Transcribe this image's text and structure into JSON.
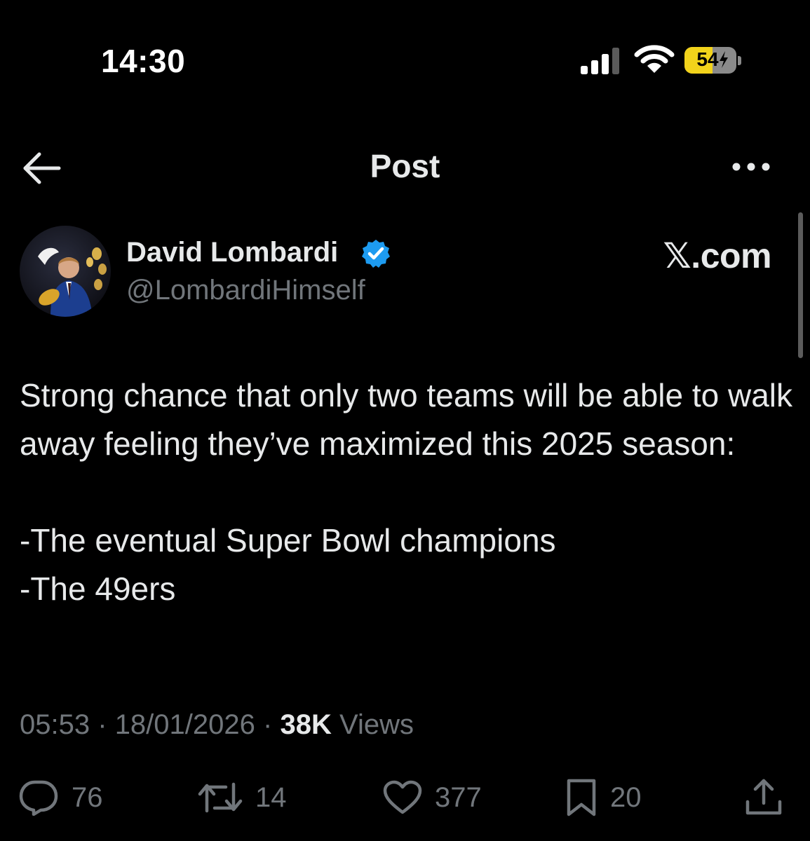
{
  "status_bar": {
    "time": "14:30",
    "battery_level": "54",
    "battery_fraction": 0.54,
    "signal_bars_active": 3,
    "signal_bars_total": 4,
    "icons": [
      "signal-icon",
      "wifi-icon",
      "battery-charging-icon"
    ]
  },
  "header": {
    "title": "Post",
    "back_icon": "arrow-left-icon",
    "more_icon": "more-horizontal-icon"
  },
  "author": {
    "name": "David Lombardi",
    "handle": "@LombardiHimself",
    "verified": true,
    "verified_color": "#1d9bf0"
  },
  "source": {
    "label": "𝕏.com"
  },
  "post": {
    "paragraph1": "Strong chance that only two teams will be able to walk away feeling they’ve maximized this 2025 season:",
    "line1": "-The eventual Super Bowl champions",
    "line2": "-The 49ers"
  },
  "meta": {
    "time": "05:53",
    "date": "18/01/2026",
    "separator": "·",
    "views_count": "38K",
    "views_label": "Views"
  },
  "actions": {
    "replies": "76",
    "reposts": "14",
    "likes": "377",
    "bookmarks": "20"
  },
  "colors": {
    "background": "#000000",
    "text_primary": "#e7e9ea",
    "text_secondary": "#71767b",
    "battery_yellow": "#f2d31b"
  }
}
